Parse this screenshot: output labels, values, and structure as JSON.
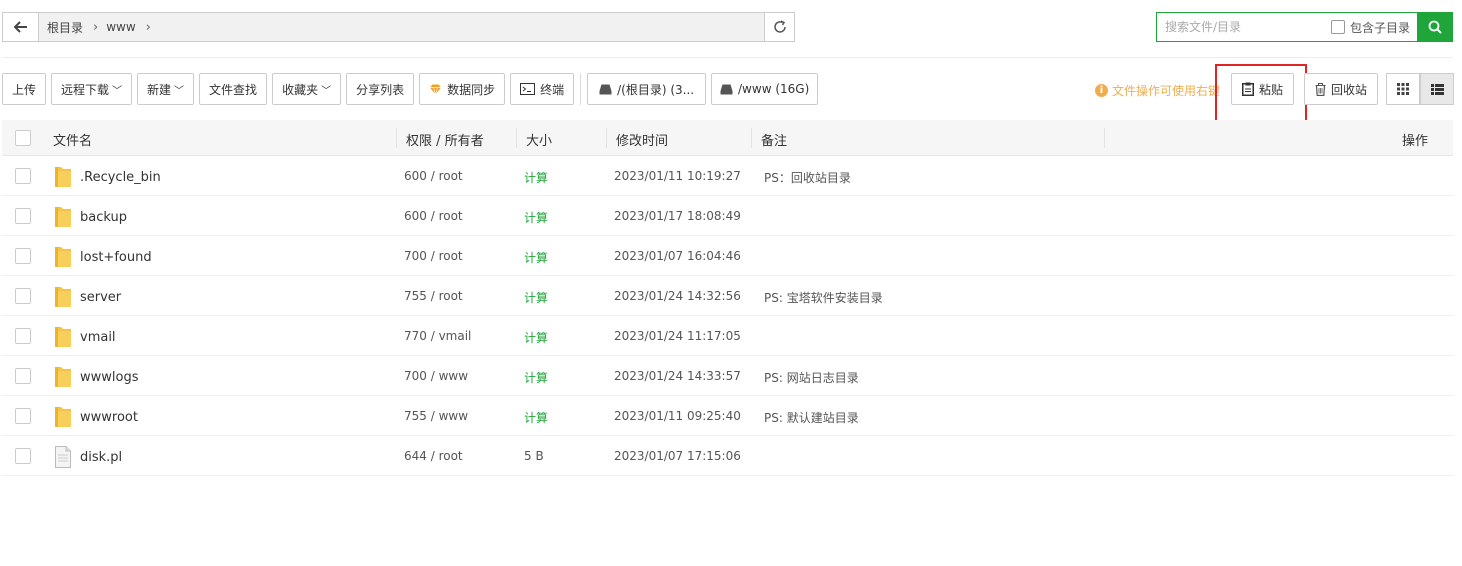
{
  "path": {
    "crumbs": [
      "根目录",
      "www"
    ]
  },
  "search": {
    "placeholder": "搜索文件/目录",
    "subdir_label": "包含子目录"
  },
  "toolbar": {
    "upload": "上传",
    "remote_download": "远程下载",
    "new": "新建",
    "file_search": "文件查找",
    "favorites": "收藏夹",
    "share_list": "分享列表",
    "data_sync": "数据同步",
    "terminal": "终端",
    "disk_root": "/(根目录) (3...",
    "disk_www": "/www (16G)"
  },
  "tip": "文件操作可使用右键",
  "paste": "粘贴",
  "recycle": "回收站",
  "table": {
    "headers": {
      "name": "文件名",
      "perm": "权限 / 所有者",
      "size": "大小",
      "mtime": "修改时间",
      "note": "备注",
      "ops": "操作"
    },
    "rows": [
      {
        "name": ".Recycle_bin",
        "type": "folder",
        "perm": "600 / root",
        "size": "计算",
        "mtime": "2023/01/11 10:19:27",
        "note": "PS：回收站目录"
      },
      {
        "name": "backup",
        "type": "folder",
        "perm": "600 / root",
        "size": "计算",
        "mtime": "2023/01/17 18:08:49",
        "note": ""
      },
      {
        "name": "lost+found",
        "type": "folder",
        "perm": "700 / root",
        "size": "计算",
        "mtime": "2023/01/07 16:04:46",
        "note": ""
      },
      {
        "name": "server",
        "type": "folder",
        "perm": "755 / root",
        "size": "计算",
        "mtime": "2023/01/24 14:32:56",
        "note": "PS: 宝塔软件安装目录"
      },
      {
        "name": "vmail",
        "type": "folder",
        "perm": "770 / vmail",
        "size": "计算",
        "mtime": "2023/01/24 11:17:05",
        "note": ""
      },
      {
        "name": "wwwlogs",
        "type": "folder",
        "perm": "700 / www",
        "size": "计算",
        "mtime": "2023/01/24 14:33:57",
        "note": "PS: 网站日志目录"
      },
      {
        "name": "wwwroot",
        "type": "folder",
        "perm": "755 / www",
        "size": "计算",
        "mtime": "2023/01/11 09:25:40",
        "note": "PS: 默认建站目录"
      },
      {
        "name": "disk.pl",
        "type": "file",
        "perm": "644 / root",
        "size": "5 B",
        "mtime": "2023/01/07 17:15:06",
        "note": ""
      }
    ]
  },
  "colors": {
    "accent": "#20a53a",
    "warning": "#f0ad4e",
    "highlight": "#e02424",
    "folder": "#f5c342"
  }
}
